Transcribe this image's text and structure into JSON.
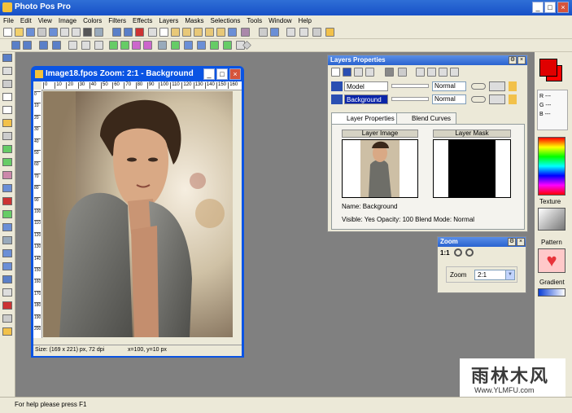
{
  "app": {
    "title": "Photo Pos Pro"
  },
  "menu": [
    "File",
    "Edit",
    "View",
    "Image",
    "Colors",
    "Filters",
    "Effects",
    "Layers",
    "Masks",
    "Selections",
    "Tools",
    "Window",
    "Help"
  ],
  "image_window": {
    "title": "Image18.fpos  Zoom: 2:1 - Background",
    "ruler_h": [
      "0",
      "10",
      "20",
      "30",
      "40",
      "50",
      "60",
      "70",
      "80",
      "90",
      "100",
      "110",
      "120",
      "130",
      "140",
      "150",
      "160"
    ],
    "ruler_v": [
      "0",
      "10",
      "20",
      "30",
      "40",
      "50",
      "60",
      "70",
      "80",
      "90",
      "100",
      "110",
      "120",
      "130",
      "140",
      "150",
      "160",
      "170",
      "180",
      "190",
      "200"
    ],
    "status_size": "Size: (169 x 221) px, 72 dpi",
    "status_pos": "x=100, y=10 px"
  },
  "layers_panel": {
    "title": "Layers Properties",
    "layers": [
      {
        "name": "Model",
        "mode": "Normal"
      },
      {
        "name": "Background",
        "mode": "Normal"
      }
    ],
    "tabs": [
      "Layer Properties",
      "Blend Curves"
    ],
    "layer_image_label": "Layer Image",
    "layer_mask_label": "Layer Mask",
    "info_name": "Name:  Background",
    "info_line": "Visible: Yes   Opacity: 100   Blend Mode: Normal"
  },
  "zoom_panel": {
    "title": "Zoom",
    "ratio": "1:1",
    "zoom_label": "Zoom",
    "zoom_value": "2:1"
  },
  "right_panel": {
    "rgb": [
      "R ---",
      "G ---",
      "B ---"
    ],
    "texture_label": "Texture",
    "pattern_label": "Pattern",
    "gradient_label": "Gradient",
    "fg_color": "#e00000",
    "bg_color": "#ff0000"
  },
  "watermark": {
    "text": "雨林木风",
    "url": "Www.YLMFU.com"
  },
  "status": "For help please press F1"
}
